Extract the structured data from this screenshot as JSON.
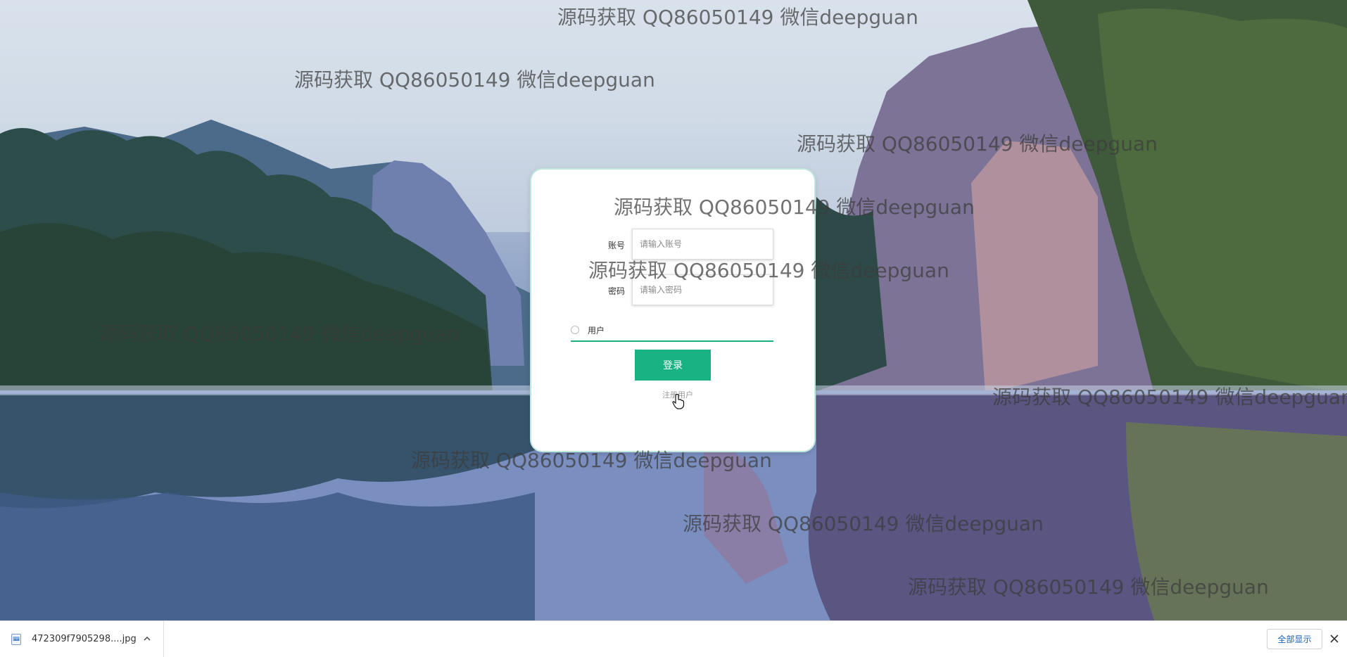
{
  "watermark_text": "源码获取 QQ86050149 微信deepguan",
  "login_form": {
    "account_label": "账号",
    "account_placeholder": "请输入账号",
    "password_label": "密码",
    "password_placeholder": "请输入密码",
    "role_option": "用户",
    "login_button": "登录",
    "register_link": "注册用户"
  },
  "download_bar": {
    "file_name": "472309f7905298....jpg",
    "show_all_label": "全部显示"
  },
  "colors": {
    "accent": "#19b283",
    "card_border": "#bfe8dc"
  }
}
